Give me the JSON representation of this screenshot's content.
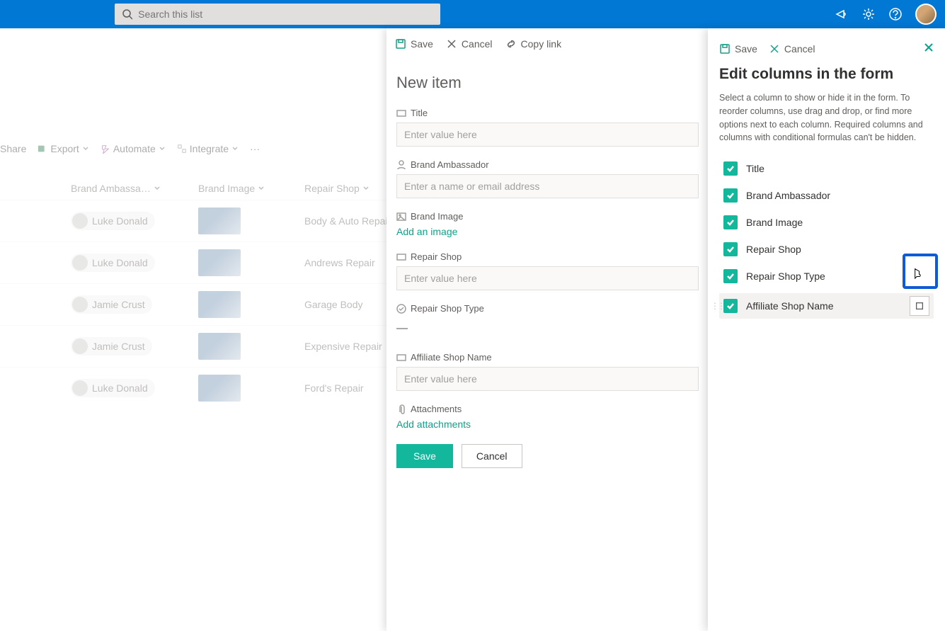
{
  "header": {
    "search_placeholder": "Search this list"
  },
  "toolbar": {
    "share": "Share",
    "export": "Export",
    "automate": "Automate",
    "integrate": "Integrate"
  },
  "table": {
    "headers": {
      "ambassador": "Brand Ambassa…",
      "image": "Brand Image",
      "shop": "Repair Shop"
    },
    "rows": [
      {
        "person": "Luke Donald",
        "shop": "Body & Auto Repair"
      },
      {
        "person": "Luke Donald",
        "shop": "Andrews Repair"
      },
      {
        "person": "Jamie Crust",
        "shop": "Garage Body"
      },
      {
        "person": "Jamie Crust",
        "shop": "Expensive Repair"
      },
      {
        "person": "Luke Donald",
        "shop": "Ford's Repair"
      }
    ]
  },
  "midPanel": {
    "topbar": {
      "save": "Save",
      "cancel": "Cancel",
      "copy": "Copy link"
    },
    "title": "New item",
    "fields": {
      "title": {
        "label": "Title",
        "placeholder": "Enter value here"
      },
      "ambassador": {
        "label": "Brand Ambassador",
        "placeholder": "Enter a name or email address"
      },
      "image": {
        "label": "Brand Image",
        "action": "Add an image"
      },
      "shop": {
        "label": "Repair Shop",
        "placeholder": "Enter value here"
      },
      "shoptype": {
        "label": "Repair Shop Type",
        "value": "—"
      },
      "affiliate": {
        "label": "Affiliate Shop Name",
        "placeholder": "Enter value here"
      },
      "attachments": {
        "label": "Attachments",
        "action": "Add attachments"
      }
    },
    "buttons": {
      "save": "Save",
      "cancel": "Cancel"
    }
  },
  "rightPanel": {
    "topbar": {
      "save": "Save",
      "cancel": "Cancel"
    },
    "title": "Edit columns in the form",
    "desc": "Select a column to show or hide it in the form. To reorder columns, use drag and drop, or find more options next to each column. Required columns and columns with conditional formulas can't be hidden.",
    "columns": [
      {
        "label": "Title",
        "checked": true
      },
      {
        "label": "Brand Ambassador",
        "checked": true
      },
      {
        "label": "Brand Image",
        "checked": true
      },
      {
        "label": "Repair Shop",
        "checked": true
      },
      {
        "label": "Repair Shop Type",
        "checked": true
      },
      {
        "label": "Affiliate Shop Name",
        "checked": true,
        "active": true
      }
    ]
  }
}
